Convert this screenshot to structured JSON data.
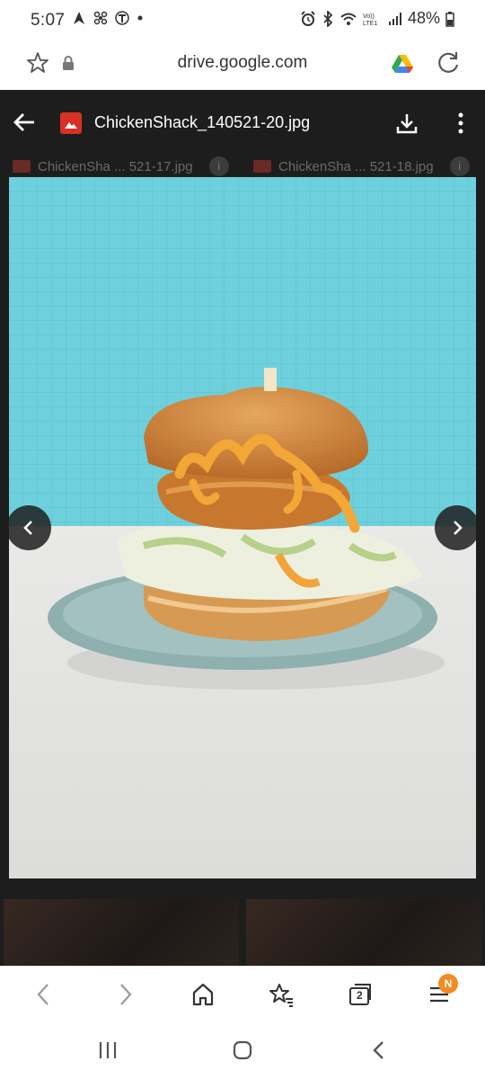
{
  "status_bar": {
    "time": "5:07",
    "battery": "48%",
    "network_label": "VoLTE1"
  },
  "browser": {
    "url": "drive.google.com"
  },
  "viewer": {
    "file_name": "ChickenShack_140521-20.jpg",
    "prev_file": "ChickenSha ... 521-17.jpg",
    "next_file": "ChickenSha ... 521-18.jpg",
    "info_glyph": "i"
  },
  "toolbar": {
    "tabs_count": "2",
    "notification_badge": "N"
  },
  "colors": {
    "brand_red": "#d93025",
    "viewer_bg": "#1d1d1d",
    "badge_orange": "#f28b22"
  }
}
